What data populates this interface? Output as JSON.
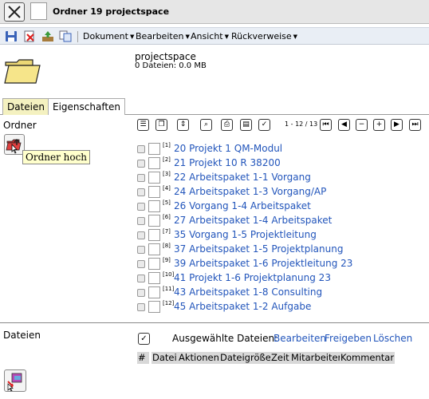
{
  "window": {
    "title": "Ordner 19 projectspace"
  },
  "menus": [
    "Dokument",
    "Bearbeiten",
    "Ansicht",
    "Rückverweise"
  ],
  "project": {
    "name": "projectspace",
    "info": "0 Dateien: 0.0 MB"
  },
  "tabs": [
    "Dateien",
    "Eigenschaften"
  ],
  "ordner_label": "Ordner",
  "tooltip": "Ordner hoch",
  "page_info": "1 - 12 / 13",
  "files": [
    {
      "num": "[1]",
      "name": "20 Projekt 1 QM-Modul"
    },
    {
      "num": "[2]",
      "name": "21 Projekt 10 R 38200"
    },
    {
      "num": "[3]",
      "name": "22 Arbeitspaket 1-1 Vorgang"
    },
    {
      "num": "[4]",
      "name": "24 Arbeitspaket 1-3 Vorgang/AP"
    },
    {
      "num": "[5]",
      "name": "26 Vorgang 1-4 Arbeitspaket"
    },
    {
      "num": "[6]",
      "name": "27 Arbeitspaket 1-4 Arbeitspaket"
    },
    {
      "num": "[7]",
      "name": "35 Vorgang 1-5 Projektleitung"
    },
    {
      "num": "[8]",
      "name": "37 Arbeitspaket 1-5 Projektplanung"
    },
    {
      "num": "[9]",
      "name": "39 Arbeitspaket 1-6 Projektleitung 23"
    },
    {
      "num": "[10]",
      "name": "41 Projekt 1-6 Projektplanung 23"
    },
    {
      "num": "[11]",
      "name": "43 Arbeitspaket 1-8 Consulting"
    },
    {
      "num": "[12]",
      "name": "45 Arbeitspaket 1-2 Aufgabe"
    }
  ],
  "dateien_section": {
    "label": "Dateien",
    "selected_label": "Ausgewählte Dateien:",
    "actions": [
      "Bearbeiten",
      "Freigeben",
      "Löschen"
    ],
    "columns": [
      "#",
      "",
      "Datei",
      "Aktionen",
      "Dateigröße",
      "Zeit",
      "Mitarbeiter",
      "Kommentar"
    ]
  },
  "colors": {
    "link": "#2255bb",
    "active_tab": "#f4f1c0",
    "tooltip_bg": "#ffffcc",
    "toolbar_bg": "#e9eef5"
  }
}
